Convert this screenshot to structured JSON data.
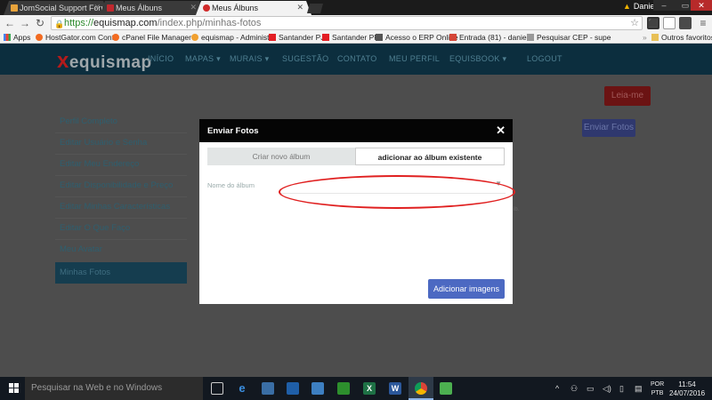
{
  "browser": {
    "tabs": [
      {
        "title": "JomSocial Support Forum",
        "active": false
      },
      {
        "title": "Meus Álbuns",
        "active": false
      },
      {
        "title": "Meus Álbuns",
        "active": true
      }
    ],
    "user": "Daniel",
    "url_protocol": "https://",
    "url_domain": "equismap.com",
    "url_path": "/index.php/minhas-fotos",
    "bookmarks": [
      {
        "label": "Apps"
      },
      {
        "label": "HostGator.com Cont"
      },
      {
        "label": "cPanel File Manager"
      },
      {
        "label": "equismap - Administ"
      },
      {
        "label": "Santander PJ"
      },
      {
        "label": "Santander PF"
      },
      {
        "label": "Acesso o ERP Online"
      },
      {
        "label": "Entrada (81) - daniel"
      },
      {
        "label": "Pesquisar CEP - supe"
      }
    ],
    "other_bookmarks": "Outros favoritos"
  },
  "site": {
    "logo": "equismap",
    "logo_x": "x",
    "nav": [
      "INÍCIO",
      "MAPAS ▾",
      "MURAIS ▾",
      "SUGESTÃO",
      "CONTATO",
      "MEU PERFIL",
      "EQUISBOOK ▾",
      "LOGOUT"
    ],
    "leia_me": "Leia-me",
    "enviar_fotos_btn": "Enviar Fotos",
    "sidebar": [
      {
        "label": "Perfil Completo"
      },
      {
        "label": "Editar Usuário e Senha"
      },
      {
        "label": "Editar Meu Endereço"
      },
      {
        "label": "Editar Disponibilidade e Preço"
      },
      {
        "label": "Editar Minhas Características"
      },
      {
        "label": "Editar O Que Faço"
      },
      {
        "label": "Meu Avatar"
      },
      {
        "label": "Minhas Fotos"
      }
    ],
    "page_snippet": "ib."
  },
  "modal": {
    "title": "Enviar Fotos",
    "tab_new": "Criar novo álbum",
    "tab_existing": "adicionar ao álbum existente",
    "field_label": "Nome do álbum",
    "field_value": "",
    "add_button": "Adicionar imagens"
  },
  "taskbar": {
    "search_placeholder": "Pesquisar na Web e no Windows",
    "language_1": "POR",
    "language_2": "PTB",
    "time": "11:54",
    "date": "24/07/2016"
  },
  "colors": {
    "modal_header": "#050505",
    "add_button": "#4c69c2",
    "annotation_ellipse": "#e02020"
  }
}
